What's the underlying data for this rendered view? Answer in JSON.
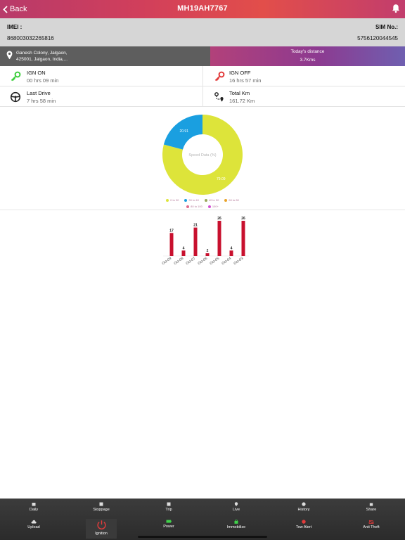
{
  "header": {
    "back_label": "Back",
    "title": "MH19AH7767"
  },
  "device": {
    "imei_label": "IMEI :",
    "imei_value": "868003032265816",
    "sim_label": "SIM No.:",
    "sim_value": "5756120044545"
  },
  "location": {
    "address_line1": "Ganesh Colony, Jalgaon,",
    "address_line2": "425001, Jalgaon, India,...",
    "distance_label": "Today's distance",
    "distance_value": "3.7Kms"
  },
  "stats": {
    "ign_on": {
      "label": "IGN ON",
      "value": "00 hrs 09 min"
    },
    "ign_off": {
      "label": "IGN OFF",
      "value": "16 hrs 57 min"
    },
    "last_drive": {
      "label": "Last Drive",
      "value": "7 hrs 58 min"
    },
    "total_km": {
      "label": "Total Km",
      "value": "161.72 Km"
    }
  },
  "chart_data": [
    {
      "type": "pie",
      "title": "Speed Data (%)",
      "slices": [
        {
          "label": "0 to 30",
          "value": 79.09,
          "display": "79.09",
          "color": "#dde43a"
        },
        {
          "label": "30 to 40",
          "value": 20.91,
          "display": "20.91",
          "color": "#1a9fe0"
        }
      ],
      "legend": [
        {
          "label": "0 to 30",
          "color": "#dde43a"
        },
        {
          "label": "30 to 40",
          "color": "#1a9fe0"
        },
        {
          "label": "40 to 50",
          "color": "#9aa85a"
        },
        {
          "label": "60 to 80",
          "color": "#e9a42b"
        },
        {
          "label": "80 to 100",
          "color": "#e06a8a"
        },
        {
          "label": "100+",
          "color": "#d34fd4"
        }
      ]
    },
    {
      "type": "bar",
      "categories": [
        "Oct-09",
        "Oct-08",
        "Oct-07",
        "Oct-06",
        "Oct-05",
        "Oct-04",
        "Oct-03"
      ],
      "values": [
        17,
        4,
        21,
        2,
        26,
        4,
        26
      ],
      "ylim": [
        0,
        26
      ],
      "color": "#c8102e"
    }
  ],
  "bottom_nav": {
    "row1": [
      "Daily",
      "Stoppage",
      "Trip",
      "Live",
      "History",
      "Share"
    ],
    "row2": [
      "Upload",
      "Power",
      "Immobilize",
      "Tow Alert",
      "Anti Theft"
    ],
    "ignition_label": "Ignition"
  }
}
